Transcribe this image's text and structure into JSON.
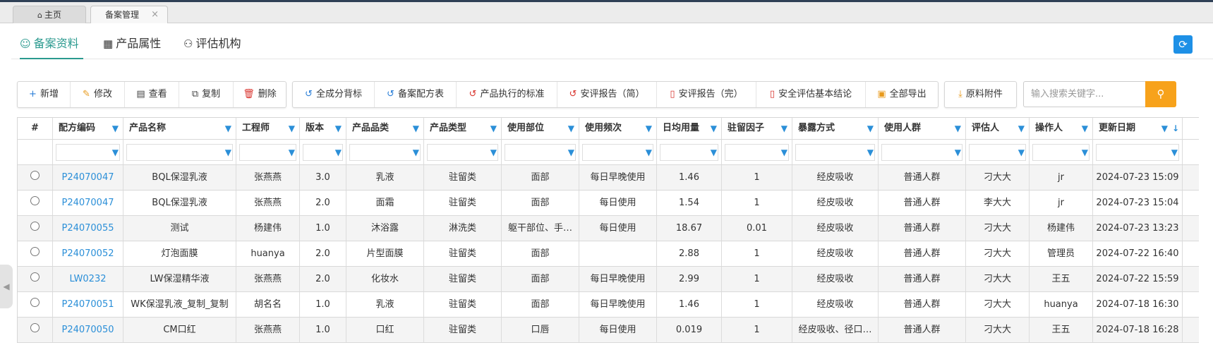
{
  "tabs": {
    "home": "主页",
    "active": "备案管理",
    "close": "×"
  },
  "subnav": [
    {
      "label": "备案资料",
      "icon": "☺"
    },
    {
      "label": "产品属性",
      "icon": "▦"
    },
    {
      "label": "评估机构",
      "icon": "⚇"
    }
  ],
  "refresh_icon": "⟳",
  "toolbar1": [
    {
      "label": "新增",
      "icon": "+",
      "color": "blue"
    },
    {
      "label": "修改",
      "icon": "✎",
      "color": "orange"
    },
    {
      "label": "查看",
      "icon": "▤",
      "color": "dark"
    },
    {
      "label": "复制",
      "icon": "⧉",
      "color": "dark"
    },
    {
      "label": "删除",
      "icon": "🗑",
      "color": "red"
    }
  ],
  "toolbar2": [
    {
      "label": "全成分背标",
      "icon": "↺",
      "color": "blue"
    },
    {
      "label": "备案配方表",
      "icon": "↺",
      "color": "blue"
    },
    {
      "label": "产品执行的标准",
      "icon": "↺",
      "color": "red"
    },
    {
      "label": "安评报告（简）",
      "icon": "↺",
      "color": "red"
    },
    {
      "label": "安评报告（完）",
      "icon": "▯",
      "color": "red"
    },
    {
      "label": "安全评估基本结论",
      "icon": "▯",
      "color": "red"
    },
    {
      "label": "全部导出",
      "icon": "▣",
      "color": "orange"
    }
  ],
  "toolbar3": [
    {
      "label": "原料附件",
      "icon": "⤓",
      "color": "orange"
    }
  ],
  "search": {
    "placeholder": "输入搜索关键字...",
    "icon": "⚲"
  },
  "table": {
    "headers": [
      "#",
      "配方编码",
      "产品名称",
      "工程师",
      "版本",
      "产品品类",
      "产品类型",
      "使用部位",
      "使用频次",
      "日均用量",
      "驻留因子",
      "暴露方式",
      "使用人群",
      "评估人",
      "操作人",
      "更新日期"
    ],
    "rows": [
      [
        "",
        "P24070047",
        "BQL保湿乳液",
        "张燕燕",
        "3.0",
        "乳液",
        "驻留类",
        "面部",
        "每日早晚使用",
        "1.46",
        "1",
        "经皮吸收",
        "普通人群",
        "刁大大",
        "jr",
        "2024-07-23 15:09"
      ],
      [
        "",
        "P24070047",
        "BQL保湿乳液",
        "张燕燕",
        "2.0",
        "面霜",
        "驻留类",
        "面部",
        "每日使用",
        "1.54",
        "1",
        "经皮吸收",
        "普通人群",
        "李大大",
        "jr",
        "2024-07-23 15:04"
      ],
      [
        "",
        "P24070055",
        "测试",
        "杨建伟",
        "1.0",
        "沐浴露",
        "淋洗类",
        "躯干部位、手…",
        "每日使用",
        "18.67",
        "0.01",
        "经皮吸收",
        "普通人群",
        "刁大大",
        "杨建伟",
        "2024-07-23 13:23"
      ],
      [
        "",
        "P24070052",
        "灯泡面膜",
        "huanya",
        "2.0",
        "片型面膜",
        "驻留类",
        "面部",
        "",
        "2.88",
        "1",
        "经皮吸收",
        "普通人群",
        "刁大大",
        "管理员",
        "2024-07-22 16:40"
      ],
      [
        "",
        "LW0232",
        "LW保湿精华液",
        "张燕燕",
        "2.0",
        "化妆水",
        "驻留类",
        "面部",
        "每日早晚使用",
        "2.99",
        "1",
        "经皮吸收",
        "普通人群",
        "刁大大",
        "王五",
        "2024-07-22 15:59"
      ],
      [
        "",
        "P24070051",
        "WK保湿乳液_复制_复制",
        "胡名名",
        "1.0",
        "乳液",
        "驻留类",
        "面部",
        "每日早晚使用",
        "1.46",
        "1",
        "经皮吸收",
        "普通人群",
        "刁大大",
        "huanya",
        "2024-07-18 16:30"
      ],
      [
        "",
        "P24070050",
        "CM口红",
        "张燕燕",
        "1.0",
        "口红",
        "驻留类",
        "口唇",
        "每日使用",
        "0.019",
        "1",
        "经皮吸收、径口…",
        "普通人群",
        "刁大大",
        "王五",
        "2024-07-18 16:28"
      ]
    ]
  },
  "filter_icon": "▼",
  "sort_icon": "↓",
  "side_handle_icon": "◀"
}
